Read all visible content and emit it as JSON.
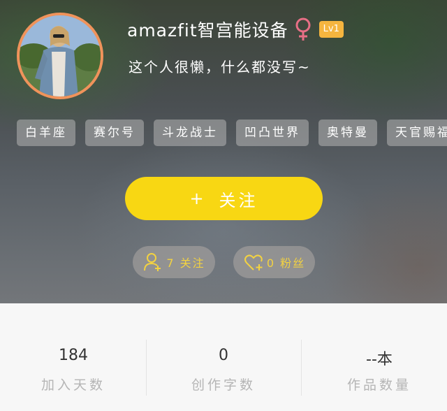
{
  "profile": {
    "username": "amazfit智宫能设备",
    "gender_icon": "female-symbol-icon",
    "level": "Lv1",
    "bio": "这个人很懒，什么都没写~",
    "colors": {
      "avatar_border": "#f0935b",
      "gender_icon": "#e86f86",
      "level_badge": "#f5b53f",
      "follow_button": "#f8d713",
      "pill_text": "#f3d241"
    }
  },
  "tags": [
    "白羊座",
    "赛尔号",
    "斗龙战士",
    "凹凸世界",
    "奥特曼",
    "天官赐福"
  ],
  "actions": {
    "follow_plus": "+",
    "follow_label": "关注"
  },
  "social": {
    "following": "7 关注",
    "fans": "0 粉丝"
  },
  "stats": [
    {
      "value": "184",
      "label": "加入天数"
    },
    {
      "value": "0",
      "label": "创作字数"
    },
    {
      "value": "--本",
      "label": "作品数量"
    }
  ]
}
